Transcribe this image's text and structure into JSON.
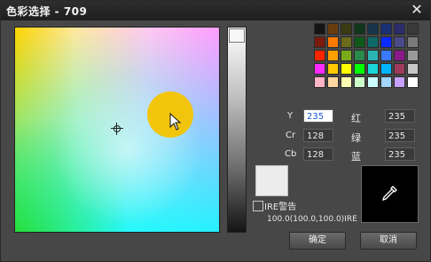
{
  "window": {
    "title": "色彩选择 - 709"
  },
  "swatches": [
    "#151515",
    "#6b3d0e",
    "#3a3a13",
    "#11361c",
    "#15344c",
    "#1a3074",
    "#2c2c6a",
    "#3a3a3a",
    "#7a1a0e",
    "#ff7a00",
    "#6b6b1a",
    "#0f5a1a",
    "#0f6a6a",
    "#0a2aff",
    "#4a4a8a",
    "#7a7a7a",
    "#ff2400",
    "#ff9f00",
    "#7aaa1a",
    "#2a8a4a",
    "#2ab4b4",
    "#3a7aff",
    "#8a1a8a",
    "#9a9a9a",
    "#ff2aff",
    "#ffc800",
    "#ffff00",
    "#00ff00",
    "#1ad6d6",
    "#00b4ff",
    "#a03a5a",
    "#c8c8c8",
    "#ffb4c8",
    "#ffd6a0",
    "#ffffb4",
    "#ccffcc",
    "#ccffff",
    "#a0d6ff",
    "#c8a0ff",
    "#ffffff"
  ],
  "fields": {
    "y": {
      "label": "Y",
      "value": "235"
    },
    "cr": {
      "label": "Cr",
      "value": "128"
    },
    "cb": {
      "label": "Cb",
      "value": "128"
    },
    "r": {
      "label": "红",
      "value": "235"
    },
    "g": {
      "label": "绿",
      "value": "235"
    },
    "b": {
      "label": "蓝",
      "value": "235"
    }
  },
  "ire": {
    "label": "IRE警告",
    "values": "100.0(100.0,100.0)IRE"
  },
  "buttons": {
    "ok": "确定",
    "cancel": "取消"
  },
  "icons": {
    "close": "close-icon",
    "eyedropper": "eyedropper-icon"
  }
}
